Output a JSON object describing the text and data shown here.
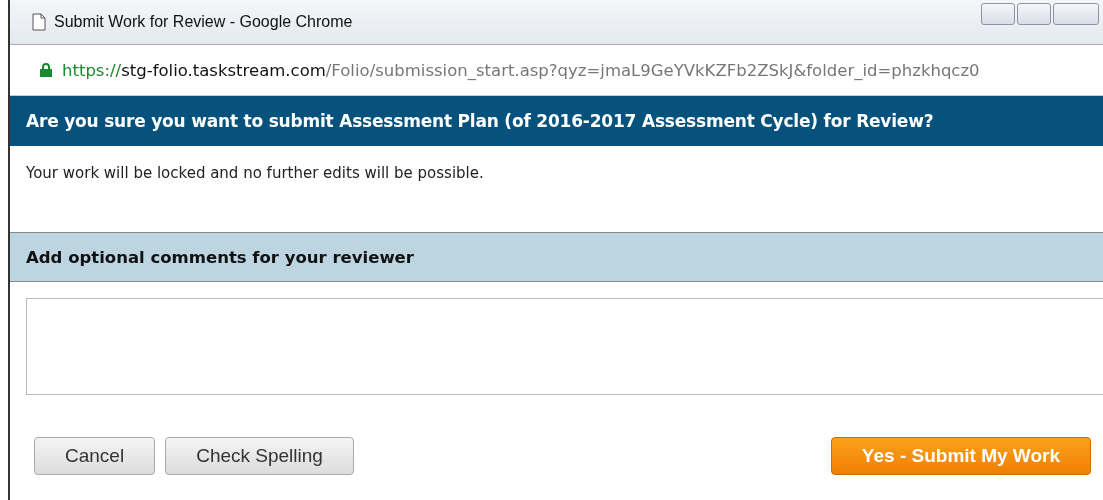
{
  "window": {
    "title": "Submit Work for Review - Google Chrome"
  },
  "address_bar": {
    "scheme": "https://",
    "host": "stg-folio.taskstream.com",
    "path": "/Folio/submission_start.asp?qyz=jmaL9GeYVkKZFb2ZSkJ&folder_id=phzkhqcz0"
  },
  "dialog": {
    "heading": "Are you sure you want to submit Assessment Plan (of 2016-2017 Assessment Cycle) for Review?",
    "message": "Your work will be locked and no further edits will be possible.",
    "comments": {
      "heading": "Add optional comments for your reviewer"
    },
    "buttons": [
      {
        "label": "Cancel",
        "kind": "secondary"
      },
      {
        "label": "Check Spelling",
        "kind": "secondary"
      },
      {
        "label": "Yes - Submit My Work",
        "kind": "primary"
      }
    ]
  }
}
